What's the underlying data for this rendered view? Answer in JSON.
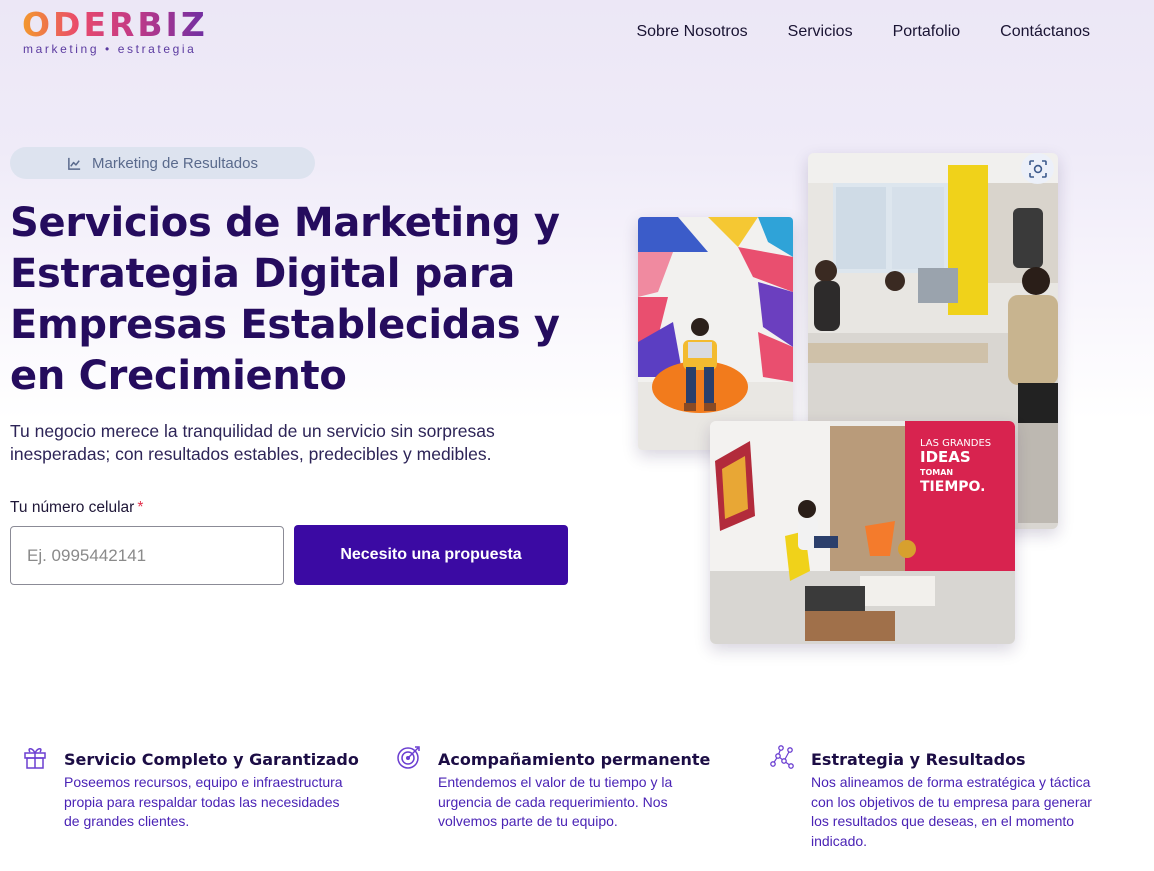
{
  "header": {
    "logo_main": "ODERBIZ",
    "logo_sub": "marketing • estrategia",
    "nav": [
      "Sobre Nosotros",
      "Servicios",
      "Portafolio",
      "Contáctanos"
    ]
  },
  "hero": {
    "pill": "Marketing de Resultados",
    "title": "Servicios de Marketing y Estrategia Digital para Empresas Establecidas y en Crecimiento",
    "subtitle": "Tu negocio merece la tranquilidad de un servicio sin sorpresas inesperadas; con resultados estables,  predecibles y medibles.",
    "phone_label": "Tu número celular",
    "phone_required_mark": "*",
    "phone_placeholder": "Ej. 0995442141",
    "cta": "Necesito una propuesta"
  },
  "photos": {
    "wall_sign_lines": [
      "LAS GRANDES",
      "IDEAS",
      "TOMAN",
      "TIEMPO."
    ]
  },
  "features": [
    {
      "icon": "gift-icon",
      "title": "Servicio Completo y Garantizado",
      "text": "Poseemos recursos, equipo e infraestructura propia para respaldar todas las necesidades de grandes clientes."
    },
    {
      "icon": "target-icon",
      "title": "Acompañamiento permanente",
      "text": "Entendemos el valor de tu tiempo y la urgencia de cada requerimiento. Nos volvemos parte de tu equipo."
    },
    {
      "icon": "network-icon",
      "title": "Estrategia y Resultados",
      "text": "Nos alineamos de forma estratégica y táctica con los objetivos de tu empresa para generar los resultados que deseas, en el momento indicado."
    }
  ],
  "colors": {
    "brand_purple": "#3b0aa3",
    "title_color": "#250c5e",
    "feature_text": "#4a23b5"
  }
}
